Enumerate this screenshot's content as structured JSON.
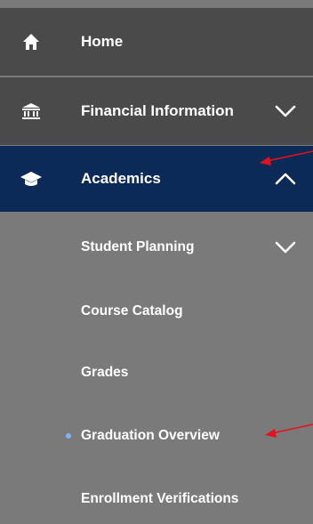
{
  "nav": {
    "top_items": [
      {
        "label": "Home",
        "icon": "home-icon"
      },
      {
        "label": "Financial Information",
        "icon": "bank-icon"
      },
      {
        "label": "Academics",
        "icon": "graduation-cap-icon"
      }
    ],
    "sub_items": [
      {
        "label": "Student Planning"
      },
      {
        "label": "Course Catalog"
      },
      {
        "label": "Grades"
      },
      {
        "label": "Graduation Overview",
        "selected": true
      },
      {
        "label": "Enrollment Verifications"
      }
    ]
  },
  "colors": {
    "top_bg": "#4a4a4a",
    "active_bg": "#0c2a57",
    "sub_bg": "#7a7a7a",
    "text": "#ffffff",
    "bullet": "#7fb2ff",
    "annotation_arrow": "#e8101c"
  }
}
